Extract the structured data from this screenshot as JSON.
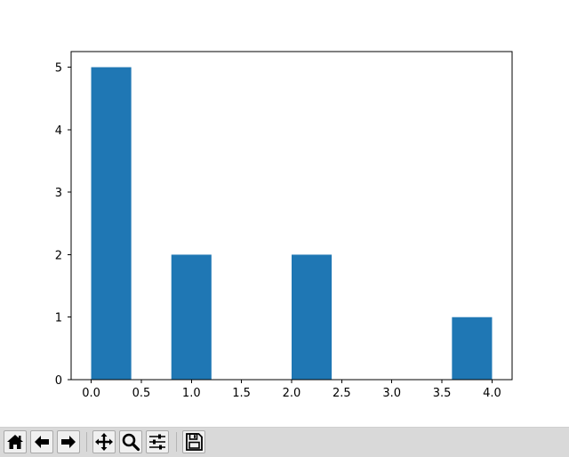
{
  "chart_data": {
    "type": "bar",
    "bins": [
      {
        "x_start": 0.0,
        "x_end": 0.4,
        "value": 5
      },
      {
        "x_start": 0.4,
        "x_end": 0.8,
        "value": 0
      },
      {
        "x_start": 0.8,
        "x_end": 1.2,
        "value": 2
      },
      {
        "x_start": 1.2,
        "x_end": 1.6,
        "value": 0
      },
      {
        "x_start": 1.6,
        "x_end": 2.0,
        "value": 0
      },
      {
        "x_start": 2.0,
        "x_end": 2.4,
        "value": 2
      },
      {
        "x_start": 2.4,
        "x_end": 2.8,
        "value": 0
      },
      {
        "x_start": 2.8,
        "x_end": 3.2,
        "value": 0
      },
      {
        "x_start": 3.2,
        "x_end": 3.6,
        "value": 0
      },
      {
        "x_start": 3.6,
        "x_end": 4.0,
        "value": 1
      }
    ],
    "xlim": [
      -0.2,
      4.2
    ],
    "ylim": [
      0,
      5.25
    ],
    "x_ticks": [
      0.0,
      0.5,
      1.0,
      1.5,
      2.0,
      2.5,
      3.0,
      3.5,
      4.0
    ],
    "x_tick_labels": [
      "0.0",
      "0.5",
      "1.0",
      "1.5",
      "2.0",
      "2.5",
      "3.0",
      "3.5",
      "4.0"
    ],
    "y_ticks": [
      0,
      1,
      2,
      3,
      4,
      5
    ],
    "y_tick_labels": [
      "0",
      "1",
      "2",
      "3",
      "4",
      "5"
    ],
    "grid": false,
    "bar_color": "#1f77b4"
  },
  "toolbar": {
    "buttons": [
      {
        "name": "home-button",
        "icon": "home-icon"
      },
      {
        "name": "back-button",
        "icon": "back-arrow-icon"
      },
      {
        "name": "forward-button",
        "icon": "forward-arrow-icon"
      },
      {
        "name": "pan-button",
        "icon": "pan-move-icon"
      },
      {
        "name": "zoom-button",
        "icon": "zoom-magnifier-icon"
      },
      {
        "name": "subplots-button",
        "icon": "sliders-icon"
      },
      {
        "name": "save-button",
        "icon": "save-floppy-icon"
      }
    ]
  }
}
